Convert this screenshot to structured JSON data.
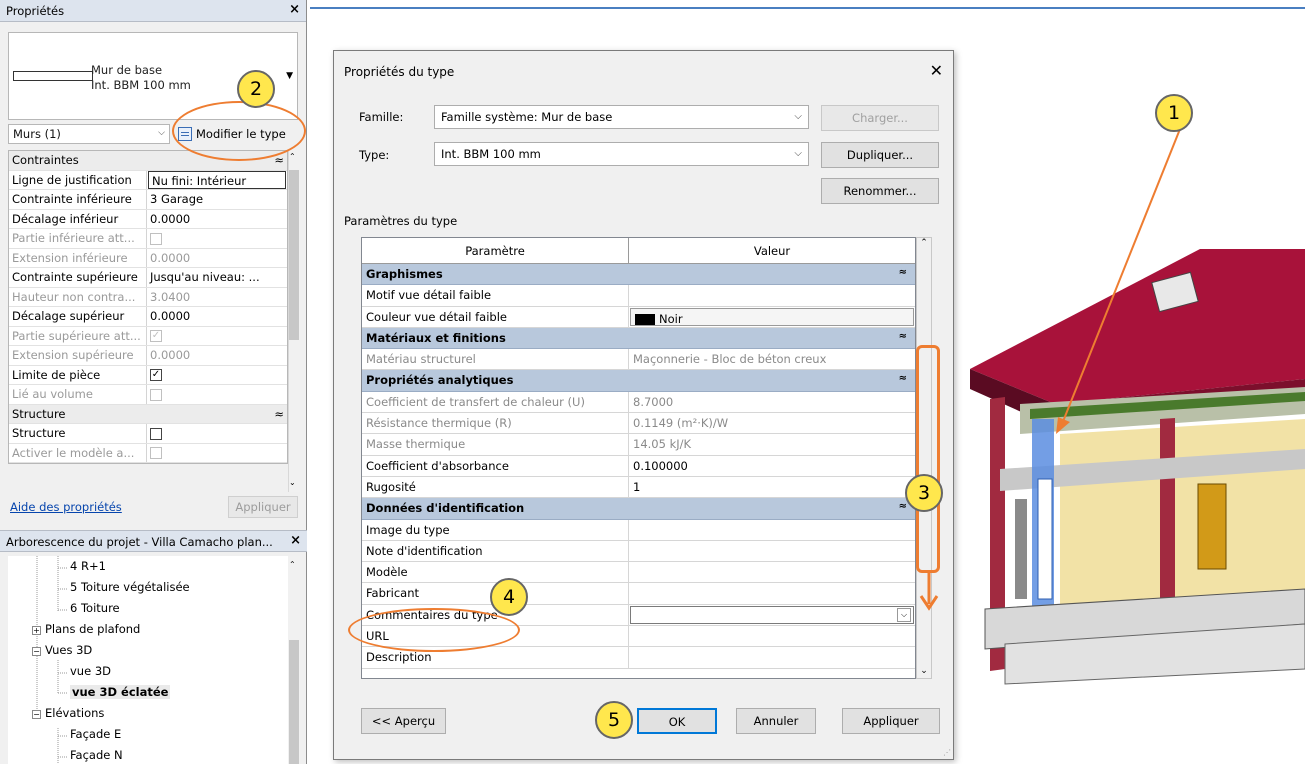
{
  "properties_panel": {
    "title": "Propriétés",
    "type_name_line1": "Mur de base",
    "type_name_line2": "Int. BBM 100 mm",
    "category_selector": "Murs (1)",
    "edit_type_label": "Modifier le type",
    "groups": {
      "constraints": "Contraintes",
      "structure": "Structure"
    },
    "rows": [
      {
        "label": "Ligne de justification",
        "value": "Nu fini: Intérieur"
      },
      {
        "label": "Contrainte inférieure",
        "value": "3 Garage"
      },
      {
        "label": "Décalage inférieur",
        "value": "0.0000"
      },
      {
        "label": "Partie inférieure att...",
        "value": ""
      },
      {
        "label": "Extension inférieure",
        "value": "0.0000"
      },
      {
        "label": "Contrainte supérieure",
        "value": "Jusqu'au niveau: ..."
      },
      {
        "label": "Hauteur non contra...",
        "value": "3.0400"
      },
      {
        "label": "Décalage supérieur",
        "value": "0.0000"
      },
      {
        "label": "Partie supérieure att...",
        "value": ""
      },
      {
        "label": "Extension supérieure",
        "value": "0.0000"
      },
      {
        "label": "Limite de pièce",
        "value": ""
      },
      {
        "label": "Lié au volume",
        "value": ""
      }
    ],
    "structure_rows": [
      {
        "label": "Structure",
        "value": ""
      },
      {
        "label": "Activer le modèle a...",
        "value": ""
      }
    ],
    "help_link": "Aide des propriétés",
    "apply_button": "Appliquer"
  },
  "project_browser": {
    "title": "Arborescence du projet - Villa Camacho plan...",
    "nodes": [
      "4 R+1",
      "5 Toiture végétalisée",
      "6 Toiture",
      "Plans de plafond",
      "Vues 3D",
      "vue 3D",
      "vue 3D éclatée",
      "Elévations",
      "Façade E",
      "Façade N"
    ]
  },
  "dialog": {
    "title": "Propriétés du type",
    "family_label": "Famille:",
    "family_value": "Famille système: Mur de base",
    "type_label": "Type:",
    "type_value": "Int. BBM 100 mm",
    "load_button": "Charger...",
    "duplicate_button": "Dupliquer...",
    "rename_button": "Renommer...",
    "params_heading": "Paramètres du type",
    "col_param": "Paramètre",
    "col_value": "Valeur",
    "groups": {
      "graphics": "Graphismes",
      "materials": "Matériaux et finitions",
      "analytical": "Propriétés analytiques",
      "identity": "Données d'identification"
    },
    "graphics_rows": [
      {
        "label": "Motif vue détail faible",
        "value": ""
      },
      {
        "label": "Couleur vue détail faible",
        "value": "Noir"
      }
    ],
    "materials_rows": [
      {
        "label": "Matériau structurel",
        "value": "Maçonnerie - Bloc de béton creux"
      }
    ],
    "analytical_rows": [
      {
        "label": "Coefficient de transfert de chaleur (U)",
        "value": "8.7000"
      },
      {
        "label": "Résistance thermique (R)",
        "value": "0.1149 (m²·K)/W"
      },
      {
        "label": "Masse thermique",
        "value": "14.05 kJ/K"
      },
      {
        "label": "Coefficient d'absorbance",
        "value": "0.100000"
      },
      {
        "label": "Rugosité",
        "value": "1"
      }
    ],
    "identity_rows": [
      {
        "label": "Image du type",
        "value": ""
      },
      {
        "label": "Note d'identification",
        "value": ""
      },
      {
        "label": "Modèle",
        "value": ""
      },
      {
        "label": "Fabricant",
        "value": ""
      },
      {
        "label": "Commentaires du type",
        "value": ""
      },
      {
        "label": "URL",
        "value": ""
      },
      {
        "label": "Description",
        "value": ""
      }
    ],
    "preview_button": "<< Aperçu",
    "ok_button": "OK",
    "cancel_button": "Annuler",
    "apply_button": "Appliquer"
  },
  "annotations": [
    "1",
    "2",
    "3",
    "4",
    "5"
  ],
  "colors": {
    "accent_orange": "#ee7d31",
    "badge_yellow": "#ffe74d",
    "group_header_blue": "#b8c8dc",
    "roof_red": "#a8123a",
    "wall_yellow": "#f2e2a6"
  }
}
